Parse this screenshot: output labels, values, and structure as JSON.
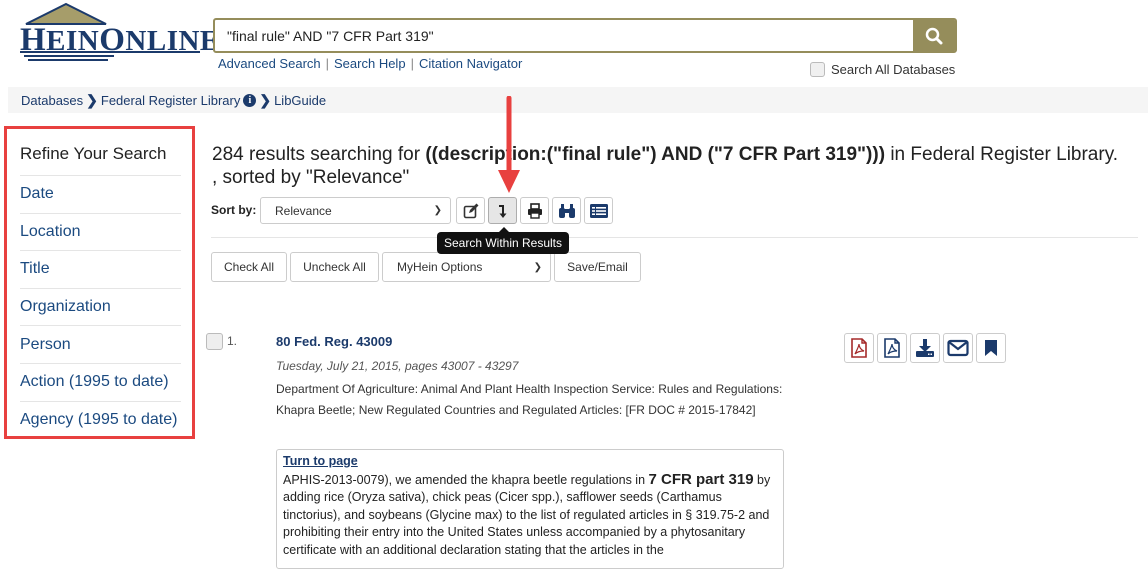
{
  "logo": {
    "text_first": "H",
    "text_rest1": "EIN",
    "text_mid": "O",
    "text_rest2": "NLINE"
  },
  "search": {
    "value": "\"final rule\" AND \"7 CFR Part 319\"",
    "links": [
      "Advanced Search",
      "Search Help",
      "Citation Navigator"
    ],
    "search_all_label": "Search All Databases",
    "search_all_checked": false,
    "button_icon": "search-icon"
  },
  "breadcrumb": [
    "Databases",
    "Federal Register Library",
    "LibGuide"
  ],
  "sidebar": {
    "title": "Refine Your Search",
    "items": [
      "Date",
      "Location",
      "Title",
      "Organization",
      "Person",
      "Action (1995 to date)",
      "Agency (1995 to date)"
    ]
  },
  "results": {
    "count_text": "284 results searching for ",
    "query_bold": "((description:(\"final rule\") AND (\"7 CFR Part 319\")))",
    "library_text": " in Federal Register Library.",
    "sorted_text": ", sorted by \"Relevance\""
  },
  "toolbar": {
    "sort_label": "Sort by:",
    "sort_value": "Relevance",
    "tools": [
      "edit-icon",
      "search-within-icon",
      "print-icon",
      "binoculars-icon",
      "list-view-icon"
    ],
    "tooltip": "Search Within Results",
    "check_all": "Check All",
    "uncheck_all": "Uncheck All",
    "myhein_value": "MyHein Options",
    "save_email": "Save/Email"
  },
  "result_items": [
    {
      "number": "1.",
      "title": "80 Fed. Reg. 43009",
      "date": "Tuesday, July 21, 2015, pages 43007 - 43297",
      "description": "Department Of Agriculture: Animal And Plant Health Inspection Service: Rules and Regulations: Khapra Beetle; New Regulated Countries and Regulated Articles: [FR DOC # 2015-17842]",
      "actions": [
        "pdf-icon",
        "pdf-outline-icon",
        "download-icon",
        "email-icon",
        "bookmark-icon"
      ],
      "snippet": {
        "link": "Turn to page",
        "before": "APHIS-2013-0079), we amended the khapra beetle regulations in ",
        "highlight": "7 CFR part 319",
        "after": " by adding rice (Oryza sativa), chick peas (Cicer spp.), safflower seeds (Carthamus tinctorius), and soybeans (Glycine max) to the list of regulated articles in § 319.75-2 and prohibiting their entry into the United States unless accompanied by a phytosanitary certificate with an additional declaration stating that the articles in the"
      }
    }
  ],
  "colors": {
    "brand_navy": "#1b3a6b",
    "search_gold": "#958d5b",
    "highlight_red": "#e8403f"
  }
}
